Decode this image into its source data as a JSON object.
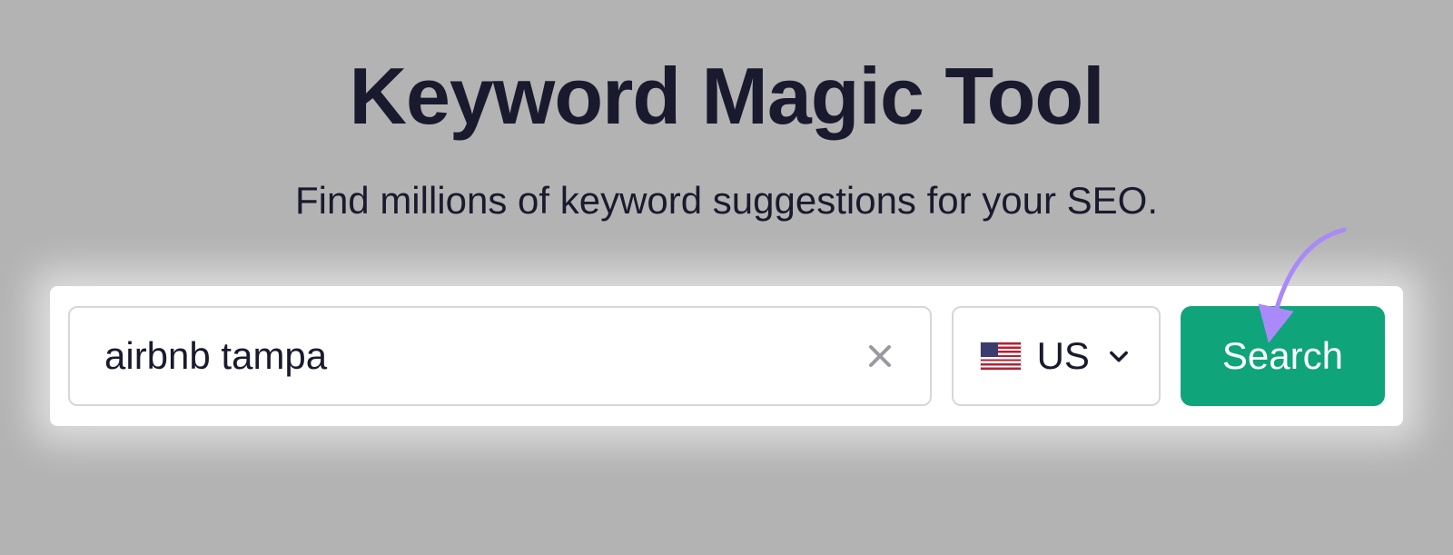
{
  "header": {
    "title": "Keyword Magic Tool",
    "subtitle": "Find millions of keyword suggestions for your SEO."
  },
  "search": {
    "input_value": "airbnb tampa",
    "input_placeholder": "",
    "country_code": "US",
    "button_label": "Search"
  }
}
